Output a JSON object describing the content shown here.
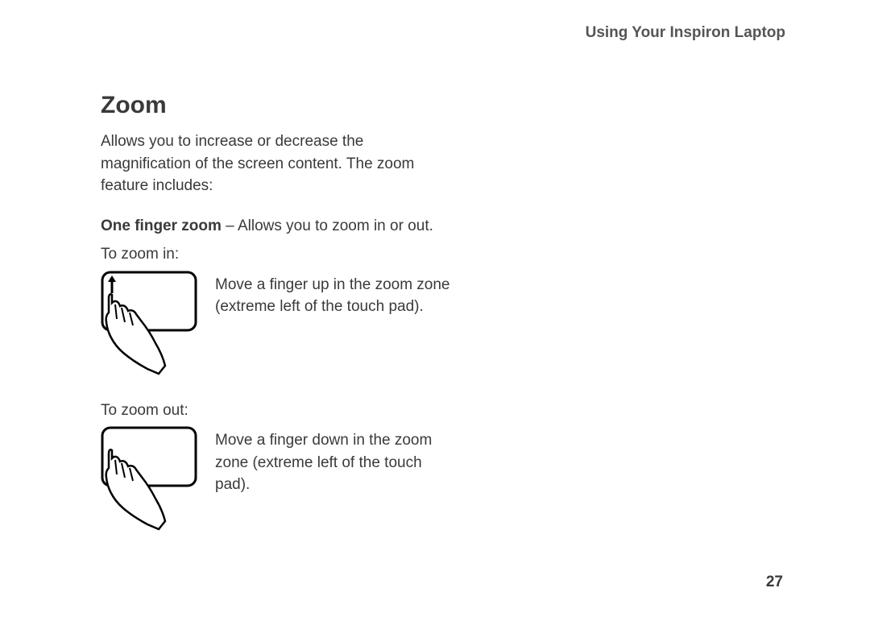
{
  "header": {
    "title": "Using Your Inspiron Laptop"
  },
  "section": {
    "title": "Zoom",
    "intro": "Allows you to increase or decrease the magnification of the screen content. The zoom feature includes:",
    "feature_bold": "One finger zoom",
    "feature_rest": " – Allows you to zoom in or out.",
    "zoom_in_label": "To zoom in:",
    "zoom_in_desc": "Move a finger up in the zoom zone (extreme left of the touch pad).",
    "zoom_out_label": "To zoom out:",
    "zoom_out_desc": "Move a finger down in the zoom zone (extreme left of the touch pad)."
  },
  "page_number": "27"
}
